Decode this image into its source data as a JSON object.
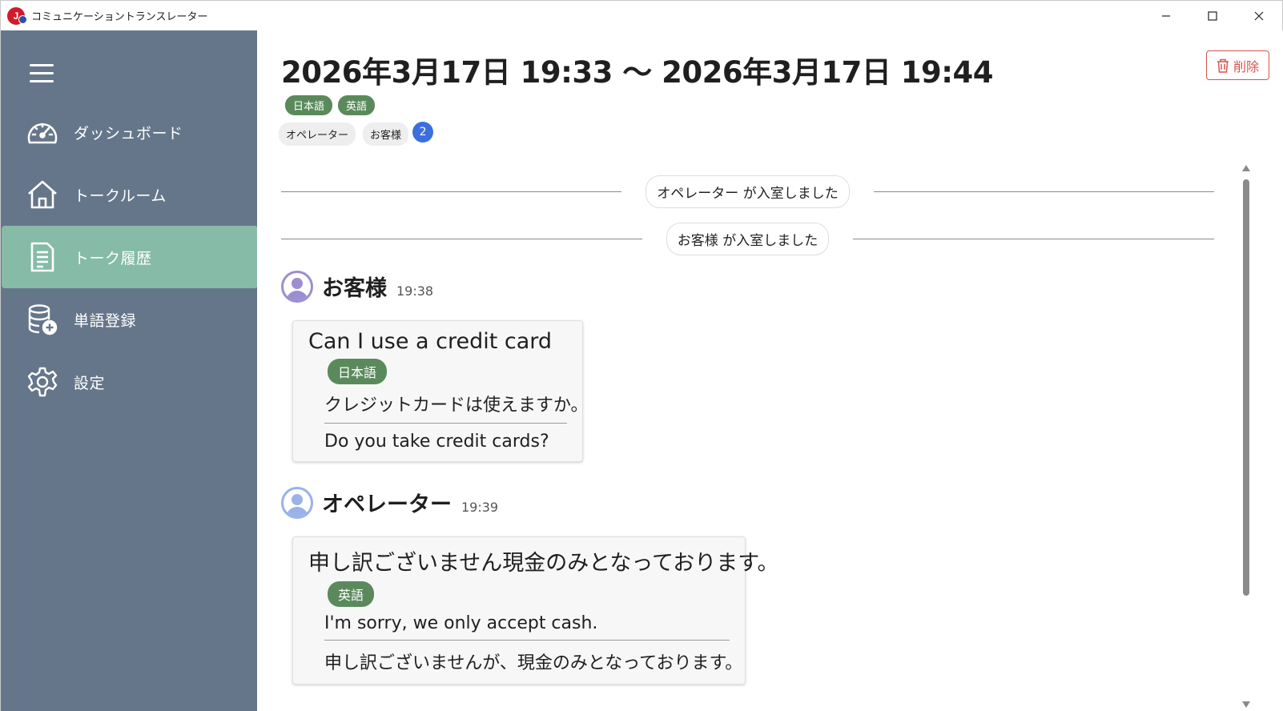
{
  "window": {
    "title": "コミュニケーショントランスレーター",
    "logo_text": "J",
    "minimize": "—",
    "maximize": "☐",
    "close": "✕"
  },
  "sidebar": {
    "items": [
      {
        "label": "ダッシュボード",
        "icon": "dashboard-gauge-icon"
      },
      {
        "label": "トークルーム",
        "icon": "home-icon"
      },
      {
        "label": "トーク履歴",
        "icon": "document-icon",
        "active": true
      },
      {
        "label": "単語登録",
        "icon": "database-add-icon"
      },
      {
        "label": "設定",
        "icon": "gear-icon"
      }
    ]
  },
  "header": {
    "title": "2026年3月17日 19:33 〜 2026年3月17日 19:44",
    "delete_label": "削除",
    "languages": [
      "日本語",
      "英語"
    ],
    "members": [
      "オペレーター",
      "お客様"
    ],
    "member_count": "2"
  },
  "events": [
    {
      "text": "オペレーター が入室しました"
    },
    {
      "text": "お客様 が入室しました"
    }
  ],
  "messages": [
    {
      "sender": "お客様",
      "time": "19:38",
      "original": "Can I use a credit card",
      "target_language": "日本語",
      "translated": "クレジットカードは使えますか。",
      "back_translation": "Do you take credit cards?"
    },
    {
      "sender": "オペレーター",
      "time": "19:39",
      "original": "申し訳ございません現金のみとなっております。",
      "target_language": "英語",
      "translated": "I'm sorry, we only accept cash.",
      "back_translation": "申し訳ございませんが、現金のみとなっております。"
    }
  ],
  "colors": {
    "sidebar_bg": "#66768a",
    "sidebar_active": "#86bba8",
    "lang_tag": "#5a8a5c",
    "count_badge": "#3b6fe0",
    "delete": "#d9534f"
  }
}
